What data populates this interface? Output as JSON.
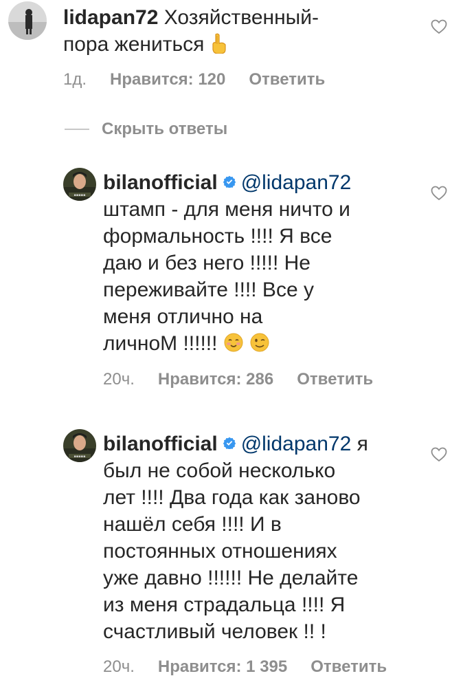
{
  "comments": [
    {
      "username": "lidapan72",
      "text_line1": " Хозяйственный-",
      "text_line2": "пора жениться ",
      "time": "1д.",
      "likes": "Нравится: 120",
      "reply": "Ответить"
    },
    {
      "username": "bilanofficial",
      "mention": "@lidapan72",
      "text": "штамп - для меня ничто и\nформальность !!!! Я все\nдаю и без него !!!!! Не\nпереживайте !!!! Все у\nменя отлично на\nличноМ !!!!!! ",
      "time": "20ч.",
      "likes": "Нравится: 286",
      "reply": "Ответить"
    },
    {
      "username": "bilanofficial",
      "mention": "@lidapan72",
      "text_after_mention": " я",
      "text": "был не собой несколько\nлет !!!! Два года как заново\nнашёл себя !!!! И в\nпостоянных отношениях\nуже давно !!!!!! Не делайте\nиз меня страдальца !!!! Я\nсчастливый человек !! !",
      "time": "20ч.",
      "likes": "Нравится: 1 395",
      "reply": "Ответить"
    }
  ],
  "hide_replies": "Скрыть ответы",
  "icons": {
    "heart": "heart-outline-icon",
    "verified": "verified-badge-icon",
    "emoji_pointing": "backhand-index-pointing-up-emoji",
    "emoji_smiling": "smiling-face-emoji",
    "emoji_winking": "winking-face-emoji"
  },
  "colors": {
    "text": "#262626",
    "meta": "#8e8e8e",
    "mention": "#00376b",
    "verified": "#3897f0"
  }
}
